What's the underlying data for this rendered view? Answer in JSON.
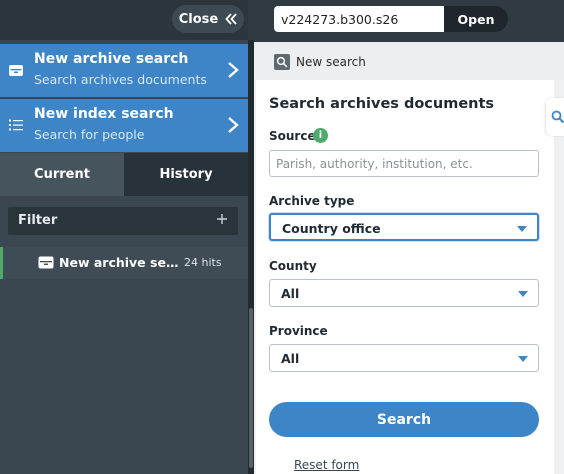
{
  "left": {
    "close_label": "Close",
    "nav": [
      {
        "title": "New archive search",
        "subtitle": "Search archives documents"
      },
      {
        "title": "New index search",
        "subtitle": "Search for people"
      }
    ],
    "tabs": {
      "current": "Current",
      "history": "History"
    },
    "filter_label": "Filter",
    "result": {
      "title": "New archive search...",
      "hits": "24 hits"
    }
  },
  "topbar": {
    "document_id": "v224273.b300.s26",
    "open_label": "Open"
  },
  "toolbar": {
    "new_search_label": "New search"
  },
  "form": {
    "heading": "Search archives documents",
    "source": {
      "label": "Source",
      "placeholder": "Parish, authority, institution, etc."
    },
    "archive_type": {
      "label": "Archive type",
      "value": "Country office"
    },
    "county": {
      "label": "County",
      "value": "All"
    },
    "province": {
      "label": "Province",
      "value": "All"
    },
    "search_label": "Search",
    "reset_label": "Reset form"
  },
  "colors": {
    "accent": "#3d85c6",
    "green": "#4fa96b",
    "sidebar_bg": "#3a4750"
  }
}
